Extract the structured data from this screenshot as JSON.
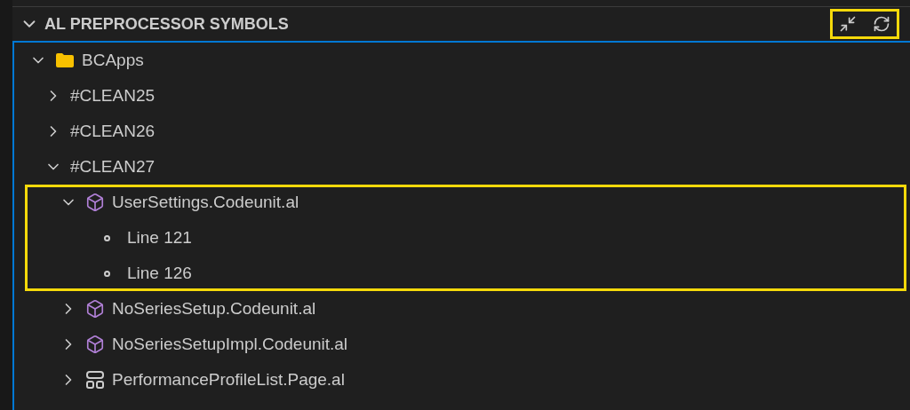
{
  "panel": {
    "title": "AL PREPROCESSOR SYMBOLS",
    "expanded": true,
    "actions_highlighted": true
  },
  "tree": [
    {
      "kind": "folder",
      "label": "BCApps",
      "expanded": true,
      "highlighted": false,
      "children": [
        {
          "kind": "group",
          "label": "#CLEAN25",
          "expanded": false,
          "highlighted": false
        },
        {
          "kind": "group",
          "label": "#CLEAN26",
          "expanded": false,
          "highlighted": false
        },
        {
          "kind": "group",
          "label": "#CLEAN27",
          "expanded": true,
          "highlighted": false,
          "children": [
            {
              "kind": "codeunit",
              "label": "UserSettings.Codeunit.al",
              "expanded": true,
              "highlighted": true,
              "children": [
                {
                  "kind": "line",
                  "label": "Line 121"
                },
                {
                  "kind": "line",
                  "label": "Line 126"
                }
              ]
            },
            {
              "kind": "codeunit",
              "label": "NoSeriesSetup.Codeunit.al",
              "expanded": false,
              "highlighted": false
            },
            {
              "kind": "codeunit",
              "label": "NoSeriesSetupImpl.Codeunit.al",
              "expanded": false,
              "highlighted": false
            },
            {
              "kind": "page",
              "label": "PerformanceProfileList.Page.al",
              "expanded": false,
              "highlighted": false
            }
          ]
        }
      ]
    }
  ]
}
